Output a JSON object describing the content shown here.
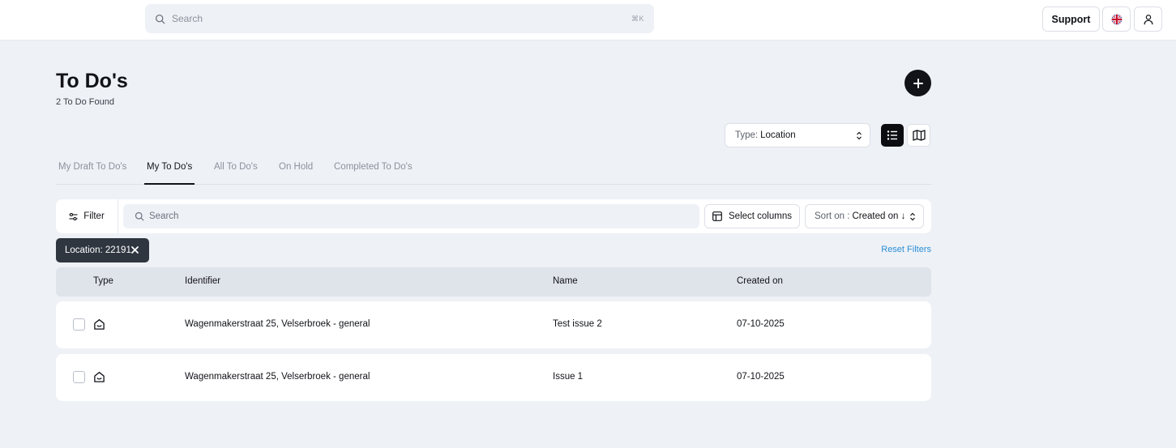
{
  "header": {
    "search_placeholder": "Search",
    "search_shortcut": "⌘K",
    "support_label": "Support",
    "language_icon": "uk-flag-icon",
    "user_icon": "user-icon"
  },
  "page": {
    "title": "To Do's",
    "subtitle": "2 To Do Found"
  },
  "type_select": {
    "label": "Type:",
    "value": "Location"
  },
  "tabs": [
    {
      "label": "My Draft To Do's",
      "active": false
    },
    {
      "label": "My To Do's",
      "active": true
    },
    {
      "label": "All To Do's",
      "active": false
    },
    {
      "label": "On Hold",
      "active": false
    },
    {
      "label": "Completed To Do's",
      "active": false
    }
  ],
  "toolbar": {
    "filter_label": "Filter",
    "search_placeholder": "Search",
    "select_columns_label": "Select columns",
    "sort_label": "Sort on :",
    "sort_value": "Created on ↓"
  },
  "active_filter": {
    "label": "Location: 22191",
    "reset_label": "Reset Filters"
  },
  "table": {
    "columns": [
      "Type",
      "Identifier",
      "Name",
      "Created on"
    ],
    "rows": [
      {
        "type_icon": "location-house-icon",
        "identifier": "Wagenmakerstraat 25, Velserbroek - general",
        "name": "Test issue 2",
        "created_on": "07-10-2025"
      },
      {
        "type_icon": "location-house-icon",
        "identifier": "Wagenmakerstraat 25, Velserbroek - general",
        "name": "Issue 1",
        "created_on": "07-10-2025"
      }
    ]
  },
  "colors": {
    "background": "#eef1f6",
    "accent_dark": "#111318",
    "chip": "#2f3640",
    "link": "#2b8fd6"
  }
}
